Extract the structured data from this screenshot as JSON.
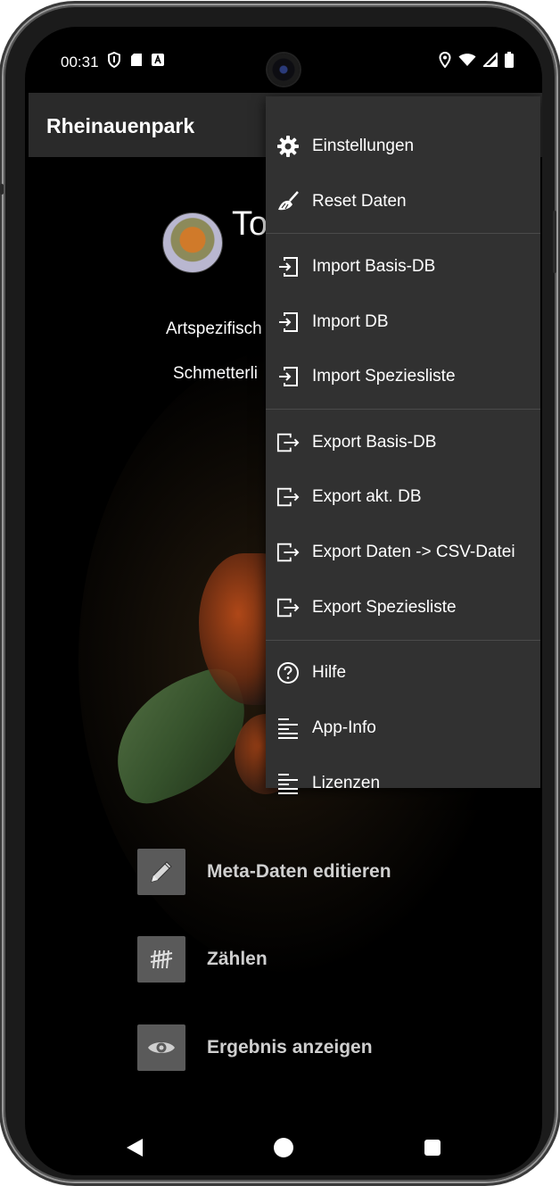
{
  "status": {
    "time": "00:31",
    "left_icons": [
      "shield-icon",
      "sdcard-icon",
      "a-badge-icon"
    ],
    "right_icons": [
      "location-icon",
      "wifi-icon",
      "signal-icon",
      "battery-icon"
    ]
  },
  "toolbar": {
    "title": "Rheinauenpark"
  },
  "content": {
    "peek_title": "To",
    "peek_line1": "Artspezifisch",
    "peek_line2": "Schmetterli",
    "actions": [
      {
        "label": "Meta-Daten editieren",
        "icon": "pencil-icon"
      },
      {
        "label": "Zählen",
        "icon": "tally-icon"
      },
      {
        "label": "Ergebnis anzeigen",
        "icon": "eye-icon"
      }
    ]
  },
  "menu": {
    "items": [
      {
        "label": "Einstellungen",
        "icon": "gear-icon"
      },
      {
        "label": "Reset Daten",
        "icon": "broom-icon"
      },
      {
        "label": "Import Basis-DB",
        "icon": "import-icon"
      },
      {
        "label": "Import DB",
        "icon": "import-icon"
      },
      {
        "label": "Import Speziesliste",
        "icon": "import-icon"
      },
      {
        "label": "Export Basis-DB",
        "icon": "export-icon"
      },
      {
        "label": "Export akt. DB",
        "icon": "export-icon"
      },
      {
        "label": "Export Daten -> CSV-Datei",
        "icon": "export-icon"
      },
      {
        "label": "Export Speziesliste",
        "icon": "export-icon"
      },
      {
        "label": "Hilfe",
        "icon": "help-icon"
      },
      {
        "label": "App-Info",
        "icon": "text-lines-icon"
      },
      {
        "label": "Lizenzen",
        "icon": "text-lines-icon"
      }
    ]
  },
  "navbar": {
    "icons": [
      "back-icon",
      "home-icon",
      "recents-icon"
    ]
  }
}
